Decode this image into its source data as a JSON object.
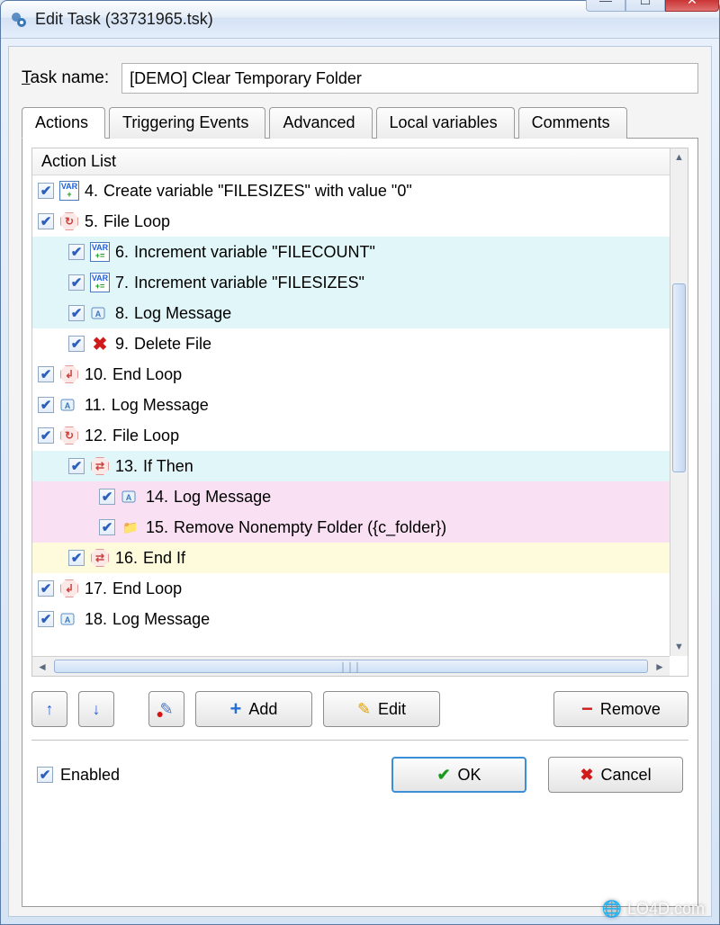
{
  "window": {
    "title": "Edit Task (33731965.tsk)"
  },
  "task_name_label": "ask name:",
  "task_name_value": "[DEMO] Clear Temporary Folder",
  "tabs": {
    "actions": "Actions",
    "triggering": "Triggering Events",
    "advanced": "Advanced",
    "local_vars": "Local variables",
    "comments": "Comments"
  },
  "list_header": "Action List",
  "actions": [
    {
      "n": "4.",
      "text": "Create variable \"FILESIZES\" with value \"0\"",
      "indent": 0,
      "bg": "",
      "icon": "var-plus"
    },
    {
      "n": "5.",
      "text": "File Loop",
      "indent": 0,
      "bg": "",
      "icon": "loop-oct"
    },
    {
      "n": "6.",
      "text": "Increment variable \"FILECOUNT\"",
      "indent": 1,
      "bg": "cyan",
      "icon": "var-inc"
    },
    {
      "n": "7.",
      "text": "Increment variable \"FILESIZES\"",
      "indent": 1,
      "bg": "cyan",
      "icon": "var-inc"
    },
    {
      "n": "8.",
      "text": "Log Message",
      "indent": 1,
      "bg": "cyan",
      "icon": "log"
    },
    {
      "n": "9.",
      "text": "Delete File",
      "indent": 1,
      "bg": "",
      "icon": "delx"
    },
    {
      "n": "10.",
      "text": "End Loop",
      "indent": 0,
      "bg": "",
      "icon": "end-oct"
    },
    {
      "n": "11.",
      "text": "Log Message",
      "indent": 0,
      "bg": "",
      "icon": "log"
    },
    {
      "n": "12.",
      "text": "File Loop",
      "indent": 0,
      "bg": "",
      "icon": "loop-oct"
    },
    {
      "n": "13.",
      "text": "If Then",
      "indent": 1,
      "bg": "cyan",
      "icon": "ifthen"
    },
    {
      "n": "14.",
      "text": "Log Message",
      "indent": 2,
      "bg": "pink",
      "icon": "log"
    },
    {
      "n": "15.",
      "text": "Remove Nonempty Folder  ({c_folder})",
      "indent": 2,
      "bg": "pink",
      "icon": "folder-del"
    },
    {
      "n": "16.",
      "text": "End If",
      "indent": 1,
      "bg": "yellow",
      "icon": "ifthen"
    },
    {
      "n": "17.",
      "text": "End Loop",
      "indent": 0,
      "bg": "",
      "icon": "end-oct"
    },
    {
      "n": "18.",
      "text": "Log Message",
      "indent": 0,
      "bg": "",
      "icon": "log"
    }
  ],
  "buttons": {
    "add": "Add",
    "edit": "Edit",
    "remove": "Remove",
    "ok": "OK",
    "cancel": "Cancel"
  },
  "enabled_label": "Enabled",
  "watermark": "LO4D.com"
}
